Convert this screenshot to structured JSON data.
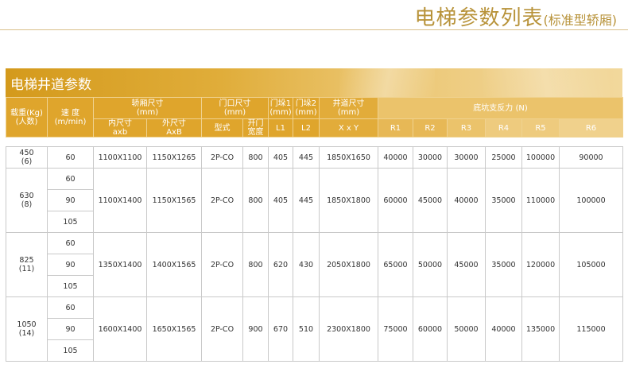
{
  "page": {
    "title_main": "电梯参数列表",
    "title_sub": "(标准型轿厢)"
  },
  "banner": {
    "title": "电梯井道参数"
  },
  "header": {
    "load": [
      "载重(Kg)",
      "(人数)"
    ],
    "speed": [
      "速 度",
      "(m/min)"
    ],
    "car_size": [
      "轿厢尺寸",
      "(mm)"
    ],
    "car_inner": [
      "内尺寸",
      "axb"
    ],
    "car_outer": [
      "外尺寸",
      "AxB"
    ],
    "door_size": [
      "门口尺寸",
      "(mm)"
    ],
    "door_type": "型式",
    "door_width": [
      "开门",
      "宽度"
    ],
    "l1_top": [
      "门垛1",
      "(mm)"
    ],
    "l1": "L1",
    "l2_top": [
      "门垛2",
      "(mm)"
    ],
    "l2": "L2",
    "shaft": [
      "井道尺寸",
      "(mm)"
    ],
    "shaft_dim": "X x Y",
    "reaction": "底坑支反力 (N)",
    "r_cols": [
      "R1",
      "R2",
      "R3",
      "R4",
      "R5",
      "R6"
    ]
  },
  "rows": [
    {
      "load": [
        "450",
        "(6)"
      ],
      "speeds": [
        "60"
      ],
      "inner": "1100X1100",
      "outer": "1150X1265",
      "door_type": "2P-CO",
      "door_width": "800",
      "l1": "405",
      "l2": "445",
      "shaft": "1850X1650",
      "r": [
        "40000",
        "30000",
        "30000",
        "25000",
        "100000",
        "90000"
      ]
    },
    {
      "load": [
        "630",
        "(8)"
      ],
      "speeds": [
        "60",
        "90",
        "105"
      ],
      "inner": "1100X1400",
      "outer": "1150X1565",
      "door_type": "2P-CO",
      "door_width": "800",
      "l1": "405",
      "l2": "445",
      "shaft": "1850X1800",
      "r": [
        "60000",
        "45000",
        "40000",
        "35000",
        "110000",
        "100000"
      ]
    },
    {
      "load": [
        "825",
        "(11)"
      ],
      "speeds": [
        "60",
        "90",
        "105"
      ],
      "inner": "1350X1400",
      "outer": "1400X1565",
      "door_type": "2P-CO",
      "door_width": "800",
      "l1": "620",
      "l2": "430",
      "shaft": "2050X1800",
      "r": [
        "65000",
        "50000",
        "45000",
        "35000",
        "120000",
        "105000"
      ]
    },
    {
      "load": [
        "1050",
        "(14)"
      ],
      "speeds": [
        "60",
        "90",
        "105"
      ],
      "inner": "1600X1400",
      "outer": "1650X1565",
      "door_type": "2P-CO",
      "door_width": "900",
      "l1": "670",
      "l2": "510",
      "shaft": "2300X1800",
      "r": [
        "75000",
        "60000",
        "50000",
        "40000",
        "135000",
        "115000"
      ]
    }
  ]
}
